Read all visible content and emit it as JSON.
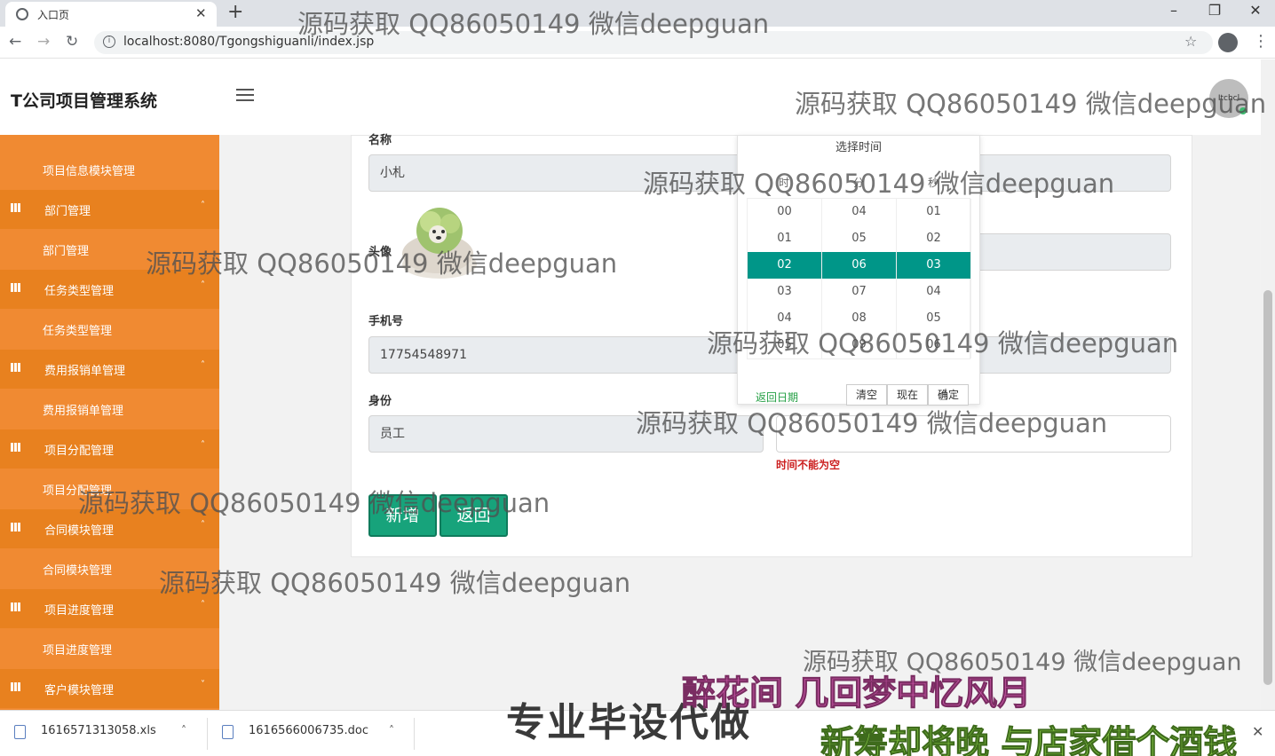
{
  "browser": {
    "tab_title": "入口页",
    "tab_close": "✕",
    "new_tab": "+",
    "url": "localhost:8080/Tgongshiguanli/index.jsp"
  },
  "header": {
    "brand": "T公司项目管理系统",
    "avatar_text": "Itchcl"
  },
  "sidebar": {
    "items": [
      {
        "type": "sub",
        "label": "项目信息模块管理"
      },
      {
        "type": "group",
        "label": "部门管理"
      },
      {
        "type": "sub",
        "label": "部门管理"
      },
      {
        "type": "group",
        "label": "任务类型管理"
      },
      {
        "type": "sub",
        "label": "任务类型管理"
      },
      {
        "type": "group",
        "label": "费用报销单管理"
      },
      {
        "type": "sub",
        "label": "费用报销单管理"
      },
      {
        "type": "group",
        "label": "项目分配管理"
      },
      {
        "type": "sub",
        "label": "项目分配管理"
      },
      {
        "type": "group",
        "label": "合同模块管理"
      },
      {
        "type": "sub",
        "label": "合同模块管理"
      },
      {
        "type": "group",
        "label": "项目进度管理"
      },
      {
        "type": "sub",
        "label": "项目进度管理"
      },
      {
        "type": "group",
        "label": "客户模块管理"
      }
    ],
    "caret_up": "˄",
    "caret_down": "˅"
  },
  "form": {
    "name_label": "名称",
    "name_value": "小札",
    "avatar_label": "头像",
    "phone_label": "手机号",
    "phone_value": "17754548971",
    "role_label": "身份",
    "role_value": "员工",
    "time_error": "时间不能为空",
    "add_button": "新增",
    "back_button": "返回"
  },
  "picker": {
    "title": "选择时间",
    "col_hour": "时",
    "col_minute": "分",
    "col_second": "秒",
    "hours": [
      "00",
      "01",
      "02",
      "03",
      "04",
      "05"
    ],
    "minutes": [
      "04",
      "05",
      "06",
      "07",
      "08",
      "09"
    ],
    "seconds": [
      "01",
      "02",
      "03",
      "04",
      "05",
      "06"
    ],
    "selected_index": 2,
    "back_to_date": "返回日期",
    "clear": "清空",
    "now": "现在",
    "confirm": "确定",
    "selected_color": "#009688"
  },
  "downloads": [
    {
      "name": "1616571313058.xls"
    },
    {
      "name": "1616566006735.doc"
    }
  ],
  "overlays": {
    "watermark": "源码获取 QQ86050149 微信deepguan",
    "promo": "专业毕设代做",
    "lyric1": "醉花间 几回梦中忆风月",
    "lyric2": "新筹却将晚 与店家借个酒钱"
  },
  "colors": {
    "sidebar": "#f08a32",
    "accent": "#17a37b",
    "error": "#cc1f1f"
  }
}
